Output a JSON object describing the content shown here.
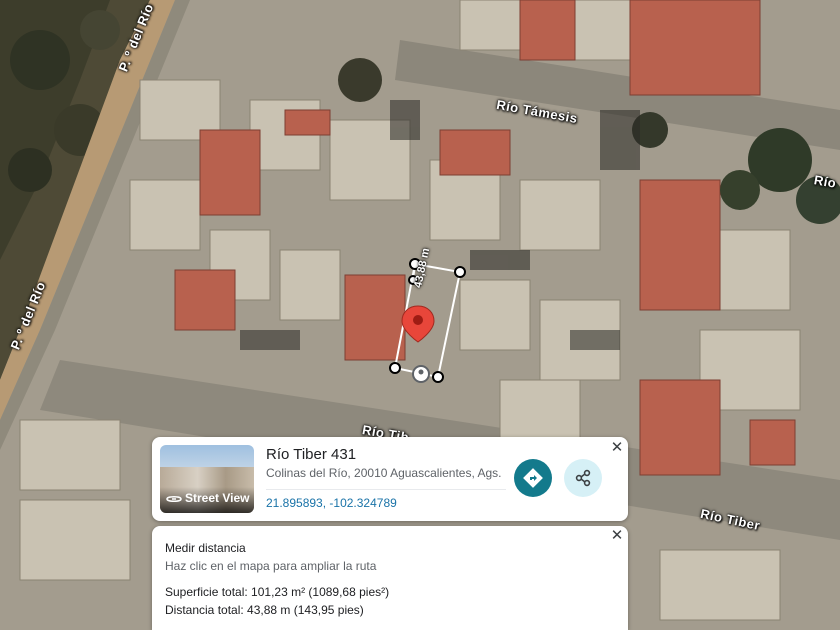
{
  "map": {
    "road_labels": {
      "po_del_rio_top": "P. º del Río",
      "po_del_rio_left": "P. º del Río",
      "rio_tamesis": "Río Támesis",
      "rio_right_edge": "Río",
      "rio_tiber_partial": "Río Tib",
      "rio_tiber": "Río Tiber"
    },
    "measurement": {
      "segment_label": "43,88 m"
    },
    "colors": {
      "pin": "#e8463a",
      "measure_line": "#ffffff"
    }
  },
  "place_card": {
    "street_view_label": "Street View",
    "title": "Río Tiber 431",
    "address": "Colinas del Río, 20010 Aguascalientes, Ags.",
    "coordinates": "21.895893, -102.324789",
    "directions_icon": "directions-icon",
    "share_icon": "share-icon",
    "accent_color": "#137a8c"
  },
  "measure_panel": {
    "title": "Medir distancia",
    "hint": "Haz clic en el mapa para ampliar la ruta",
    "area": "Superficie total: 101,23 m² (1089,68 pies²)",
    "distance": "Distancia total: 43,88 m (143,95 pies)"
  }
}
